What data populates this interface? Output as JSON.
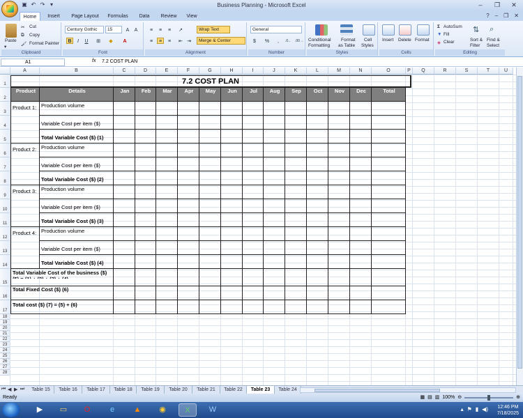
{
  "window": {
    "title": "Business Planning - Microsoft Excel",
    "minimize": "–",
    "restore": "❐",
    "close": "✕"
  },
  "ribbon_tabs": [
    "Home",
    "Insert",
    "Page Layout",
    "Formulas",
    "Data",
    "Review",
    "View"
  ],
  "ribbon": {
    "clipboard": {
      "paste": "Paste",
      "cut": "Cut",
      "copy": "Copy",
      "format_painter": "Format Painter",
      "label": "Clipboard"
    },
    "font": {
      "name": "Century Gothic",
      "size": "15",
      "label": "Font"
    },
    "alignment": {
      "wrap_text": "Wrap Text",
      "merge_center": "Merge & Center",
      "label": "Alignment"
    },
    "number": {
      "format": "General",
      "currency": "$",
      "percent": "%",
      "comma": ",",
      "label": "Number"
    },
    "styles": {
      "conditional": "Conditional",
      "conditional2": "Formatting",
      "format_table": "Format",
      "format_table2": "as Table",
      "cell_styles": "Cell",
      "cell_styles2": "Styles",
      "label": "Styles"
    },
    "cells": {
      "insert": "Insert",
      "delete": "Delete",
      "format": "Format",
      "label": "Cells"
    },
    "editing": {
      "autosum": "AutoSum",
      "fill": "Fill",
      "clear": "Clear",
      "sort": "Sort &",
      "sort2": "Filter",
      "find": "Find &",
      "find2": "Select",
      "label": "Editing"
    }
  },
  "formula_bar": {
    "cell_ref": "A1",
    "fx": "fx",
    "content": "7.2 COST PLAN"
  },
  "columns": [
    "A",
    "B",
    "C",
    "D",
    "E",
    "F",
    "G",
    "H",
    "I",
    "J",
    "K",
    "L",
    "M",
    "N",
    "O",
    "P",
    "Q",
    "R",
    "S",
    "T",
    "U"
  ],
  "rows": [
    "1",
    "2",
    "3",
    "4",
    "5",
    "6",
    "7",
    "8",
    "9",
    "10",
    "11",
    "12",
    "13",
    "14",
    "15",
    "16",
    "17",
    "18",
    "19",
    "20",
    "21",
    "22",
    "23",
    "24",
    "25",
    "26",
    "27",
    "28"
  ],
  "table": {
    "title": "7.2 COST PLAN",
    "headers": [
      "Product",
      "Details",
      "Jan",
      "Feb",
      "Mar",
      "Apr",
      "May",
      "Jun",
      "Jul",
      "Aug",
      "Sep",
      "Oct",
      "Nov",
      "Dec",
      "Total"
    ],
    "products": [
      {
        "name": "Product 1:",
        "volume": "Production volume",
        "var_cost": "Variable Cost per item ($)",
        "total": "Total Variable Cost ($) (1)"
      },
      {
        "name": "Product 2:",
        "volume": "Production volume",
        "var_cost": "Variable Cost per item ($)",
        "total": "Total Variable Cost ($) (2)"
      },
      {
        "name": "Product 3:",
        "volume": "Production volume",
        "var_cost": "Variable Cost per item ($)",
        "total": "Total Variable Cost ($) (3)"
      },
      {
        "name": "Product 4:",
        "volume": "Production volume",
        "var_cost": "Variable Cost per item ($)",
        "total": "Total Variable Cost ($) (4)"
      }
    ],
    "business_total": "Total Variable Cost of the business ($)",
    "business_total_formula": "(5) = (1) + (2) + (3) + (4)",
    "fixed": "Total Fixed Cost ($) (6)",
    "grand": "Total cost ($) (7) = (5) + (6)"
  },
  "sheet_tabs": [
    "Table 15",
    "Table 16",
    "Table 17",
    "Table 18",
    "Table 19",
    "Table 20",
    "Table 21",
    "Table 22",
    "Table 23",
    "Table 24"
  ],
  "active_sheet": "Table 23",
  "status": {
    "ready": "Ready",
    "zoom": "100%"
  },
  "clock": {
    "time": "12:46 PM",
    "date": "7/18/2025"
  }
}
